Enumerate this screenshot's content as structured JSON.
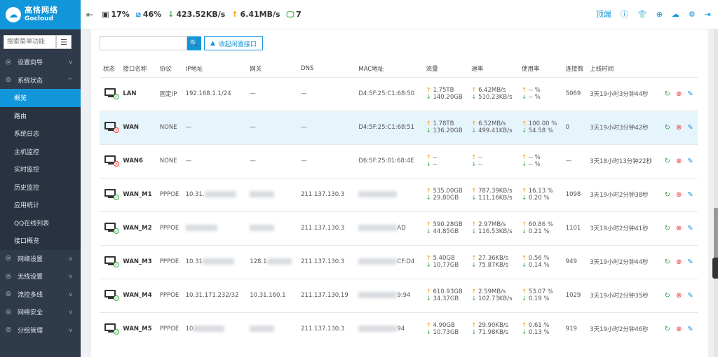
{
  "brand": {
    "cn": "高恪网络",
    "en": "Gocloud"
  },
  "sidebar": {
    "search_placeholder": "搜索菜单功能",
    "items": [
      {
        "label": "设置向导",
        "icon": "compass-icon"
      },
      {
        "label": "系统状态",
        "icon": "dashboard-icon"
      },
      {
        "label": "概览",
        "sub": true,
        "active": true
      },
      {
        "label": "路由",
        "sub": true
      },
      {
        "label": "系统日志",
        "sub": true
      },
      {
        "label": "主机监控",
        "sub": true
      },
      {
        "label": "实时监控",
        "sub": true
      },
      {
        "label": "历史监控",
        "sub": true
      },
      {
        "label": "应用统计",
        "sub": true
      },
      {
        "label": "QQ在线列表",
        "sub": true
      },
      {
        "label": "接口概览",
        "sub": true
      },
      {
        "label": "网络设置",
        "icon": "monitor-icon"
      },
      {
        "label": "无线设置",
        "icon": "wifi-icon"
      },
      {
        "label": "流控多线",
        "icon": "flow-icon"
      },
      {
        "label": "网络安全",
        "icon": "shield-icon"
      },
      {
        "label": "分组管理",
        "icon": "group-icon"
      }
    ]
  },
  "topbar": {
    "cpu": "17%",
    "mem": "46%",
    "down": "423.52KB/s",
    "up": "6.41MB/s",
    "devices": "7",
    "login_label": "顶端"
  },
  "toolbar": {
    "collapse_label": "收起闲置接口"
  },
  "table": {
    "headers": [
      "状态",
      "接口名称",
      "协议",
      "IP地址",
      "网关",
      "DNS",
      "MAC地址",
      "流量",
      "速率",
      "使用率",
      "连接数",
      "上线时间"
    ],
    "rows": [
      {
        "status": "ok",
        "name": "LAN",
        "proto": "固定IP",
        "ip": "192.168.1.1/24",
        "gw": "—",
        "dns": "—",
        "mac": "D4:5F:25:C1:68:50",
        "tx": "1.75TB",
        "rx": "140.20GB",
        "rate_up": "6.42MB/s",
        "rate_dn": "510.23KB/s",
        "use_up": "-- %",
        "use_dn": "-- %",
        "conn": "5069",
        "time": "3天19小时3分钟44秒"
      },
      {
        "status": "bad",
        "name": "WAN",
        "proto": "NONE",
        "ip": "—",
        "gw": "—",
        "dns": "—",
        "mac": "D4:5F:25:C1:68:51",
        "tx": "1.78TB",
        "rx": "136.20GB",
        "rate_up": "6.52MB/s",
        "rate_dn": "499.41KB/s",
        "use_up": "100.00 %",
        "use_dn": "54.58 %",
        "conn": "0",
        "time": "3天19小时3分钟42秒",
        "highlight": true
      },
      {
        "status": "bad",
        "name": "WAN6",
        "proto": "NONE",
        "ip": "—",
        "gw": "—",
        "dns": "—",
        "mac": "D6:5F:25:01:68:4E",
        "tx": "--",
        "rx": "--",
        "rate_up": "--",
        "rate_dn": "--",
        "use_up": "-- %",
        "use_dn": "-- %",
        "conn": "—",
        "time": "3天18小时13分钟22秒"
      },
      {
        "status": "ok",
        "name": "WAN_M1",
        "proto": "PPPOE",
        "ip": "10.31.",
        "gw": "",
        "dns": "211.137.130.3",
        "mac": "",
        "tx": "535.00GB",
        "rx": "29.80GB",
        "rate_up": "787.39KB/s",
        "rate_dn": "111.16KB/s",
        "use_up": "16.13 %",
        "use_dn": "0.20 %",
        "conn": "1098",
        "time": "3天19小时2分钟38秒"
      },
      {
        "status": "ok",
        "name": "WAN_M2",
        "proto": "PPPOE",
        "ip": "",
        "gw": "",
        "dns": "211.137.130.3",
        "mac": "AD",
        "tx": "590.28GB",
        "rx": "44.85GB",
        "rate_up": "2.97MB/s",
        "rate_dn": "116.53KB/s",
        "use_up": "60.86 %",
        "use_dn": "0.21 %",
        "conn": "1101",
        "time": "3天19小时2分钟41秒"
      },
      {
        "status": "ok",
        "name": "WAN_M3",
        "proto": "PPPOE",
        "ip": "10.31",
        "gw": "128.1",
        "dns": "211.137.130.3",
        "mac": "CF:D4",
        "tx": "5.40GB",
        "rx": "10.77GB",
        "rate_up": "27.36KB/s",
        "rate_dn": "75.87KB/s",
        "use_up": "0.56 %",
        "use_dn": "0.14 %",
        "conn": "949",
        "time": "3天19小时2分钟44秒"
      },
      {
        "status": "ok",
        "name": "WAN_M4",
        "proto": "PPPOE",
        "ip": "10.31.171.232/32",
        "gw": "10.31.160.1",
        "dns": "211.137.130.19",
        "mac": "9:94",
        "tx": "610.93GB",
        "rx": "34.37GB",
        "rate_up": "2.59MB/s",
        "rate_dn": "102.73KB/s",
        "use_up": "53.07 %",
        "use_dn": "0.19 %",
        "conn": "1029",
        "time": "3天19小时2分钟35秒"
      },
      {
        "status": "ok",
        "name": "WAN_M5",
        "proto": "PPPOE",
        "ip": "10",
        "gw": "",
        "dns": "211.137.130.3",
        "mac": "94",
        "tx": "4.90GB",
        "rx": "10.73GB",
        "rate_up": "29.90KB/s",
        "rate_dn": "71.98KB/s",
        "use_up": "0.61 %",
        "use_dn": "0.13 %",
        "conn": "919",
        "time": "3天19小时2分钟46秒"
      }
    ]
  }
}
